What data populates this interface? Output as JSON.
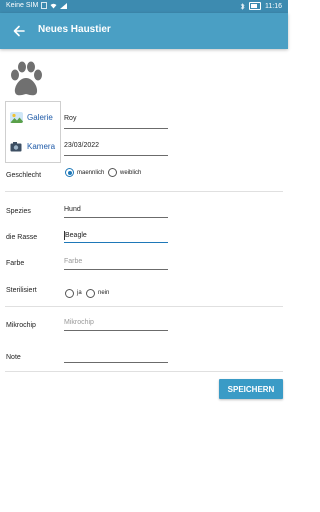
{
  "status_bar": {
    "carrier": "Keine SIM",
    "time": "11:16"
  },
  "app_bar": {
    "title": "Neues Haustier"
  },
  "icons": {
    "back": "arrow-left-icon",
    "pet": "paw-icon",
    "gallery": "gallery-image-icon",
    "camera": "camera-icon"
  },
  "media": {
    "gallery_label": "Galerie",
    "camera_label": "Kamera"
  },
  "form": {
    "name_value": "Roy",
    "date_value": "23/03/2022",
    "gender_label": "Geschlecht",
    "gender_options": [
      "maennlich",
      "weiblich"
    ],
    "gender_selected": "maennlich",
    "species_label": "Spezies",
    "species_value": "Hund",
    "breed_label": "die Rasse",
    "breed_value": "Beagle",
    "color_label": "Farbe",
    "color_placeholder": "Farbe",
    "sterilized_label": "Sterilisiert",
    "sterilized_options": [
      "ja",
      "nein"
    ],
    "microchip_label": "Mikrochip",
    "microchip_placeholder": "Mikrochip",
    "note_label": "Note",
    "note_value": ""
  },
  "actions": {
    "save_label": "SPEICHERN"
  },
  "colors": {
    "app_bar": "#4a9fc4",
    "status_bar": "#3d8bb0",
    "accent": "#1e78b8",
    "button": "#3a9bc6"
  }
}
